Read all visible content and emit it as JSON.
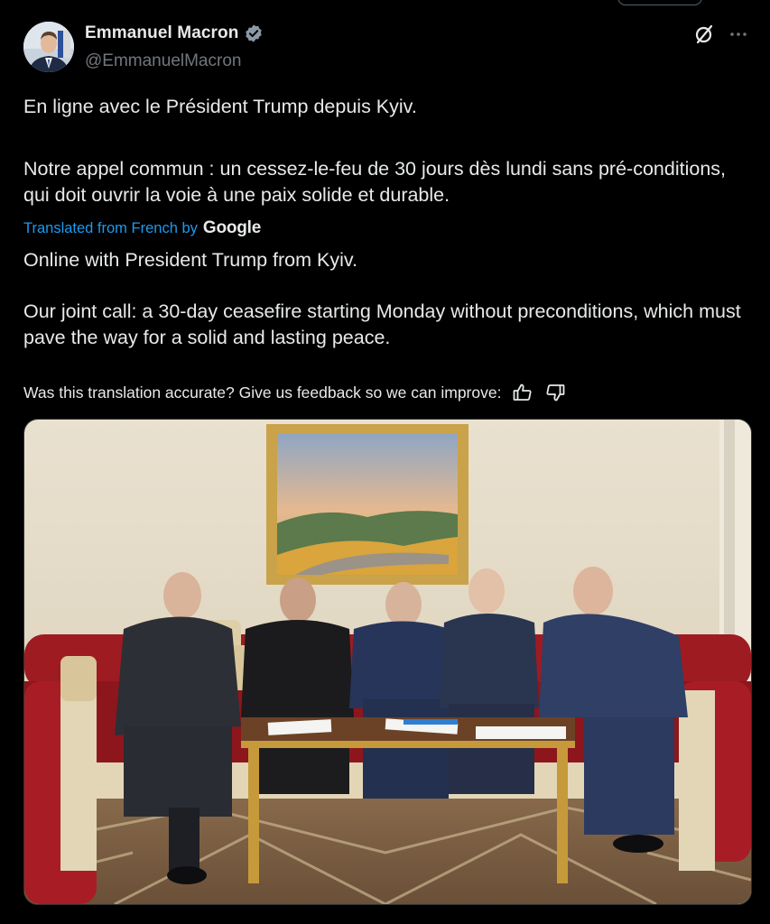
{
  "author": {
    "display_name": "Emmanuel Macron",
    "handle": "@EmmanuelMacron",
    "verified": true,
    "verified_color": "#8b98a5"
  },
  "tweet": {
    "original_line1": "En ligne avec le Président Trump depuis Kyiv.",
    "original_line2": "Notre appel commun : un cessez-le-feu de 30 jours dès lundi sans pré-conditions, qui doit ouvrir la voie à une paix solide et durable.",
    "translated_label": "Translated from French by",
    "translator": "Google",
    "translated_line1": "Online with President Trump from Kyiv.",
    "translated_line2": "Our joint call: a 30-day ceasefire starting Monday without preconditions, which must pave the way for a solid and lasting peace.",
    "feedback_prompt": "Was this translation accurate? Give us feedback so we can improve:"
  },
  "icons": {
    "grok": "grok-icon",
    "more": "more-icon",
    "thumbs_up": "thumbs-up-icon",
    "thumbs_down": "thumbs-down-icon"
  },
  "colors": {
    "background": "#000000",
    "text": "#e7e9ea",
    "secondary": "#71767b",
    "link": "#1d9bf0"
  }
}
